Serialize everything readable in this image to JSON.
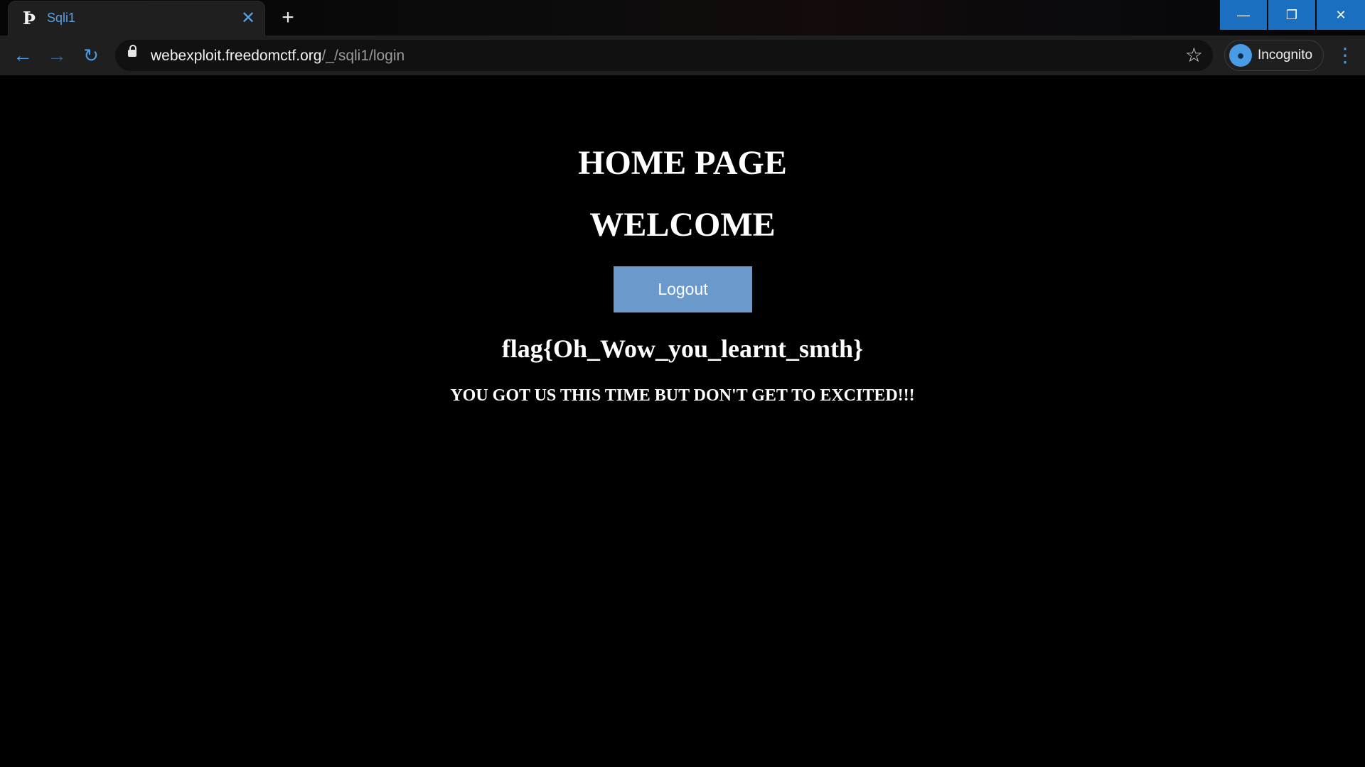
{
  "browser": {
    "tab": {
      "favicon": "p-logo-icon",
      "title": "Sqli1",
      "close_glyph": "✕"
    },
    "new_tab_glyph": "+",
    "window_controls": {
      "minimize_glyph": "—",
      "restore_glyph": "❐",
      "close_glyph": "✕"
    },
    "nav": {
      "back_glyph": "←",
      "forward_glyph": "→",
      "reload_glyph": "↻"
    },
    "address": {
      "host": "webexploit.freedomctf.org",
      "path": "/_/sqli1/login"
    },
    "bookmark_glyph": "☆",
    "profile": {
      "label": "Incognito",
      "icon": "incognito-icon"
    },
    "menu_glyph": "⋮"
  },
  "page": {
    "heading": "HOME PAGE",
    "welcome": "WELCOME",
    "logout_label": "Logout",
    "flag": "flag{Oh_Wow_you_learnt_smth}",
    "message": "YOU GOT US THIS TIME BUT DON'T GET TO EXCITED!!!"
  },
  "colors": {
    "page_background": "#000000",
    "logout_button": "#6a9acb",
    "accent": "#4a9be6",
    "window_control": "#1a6fc1"
  }
}
